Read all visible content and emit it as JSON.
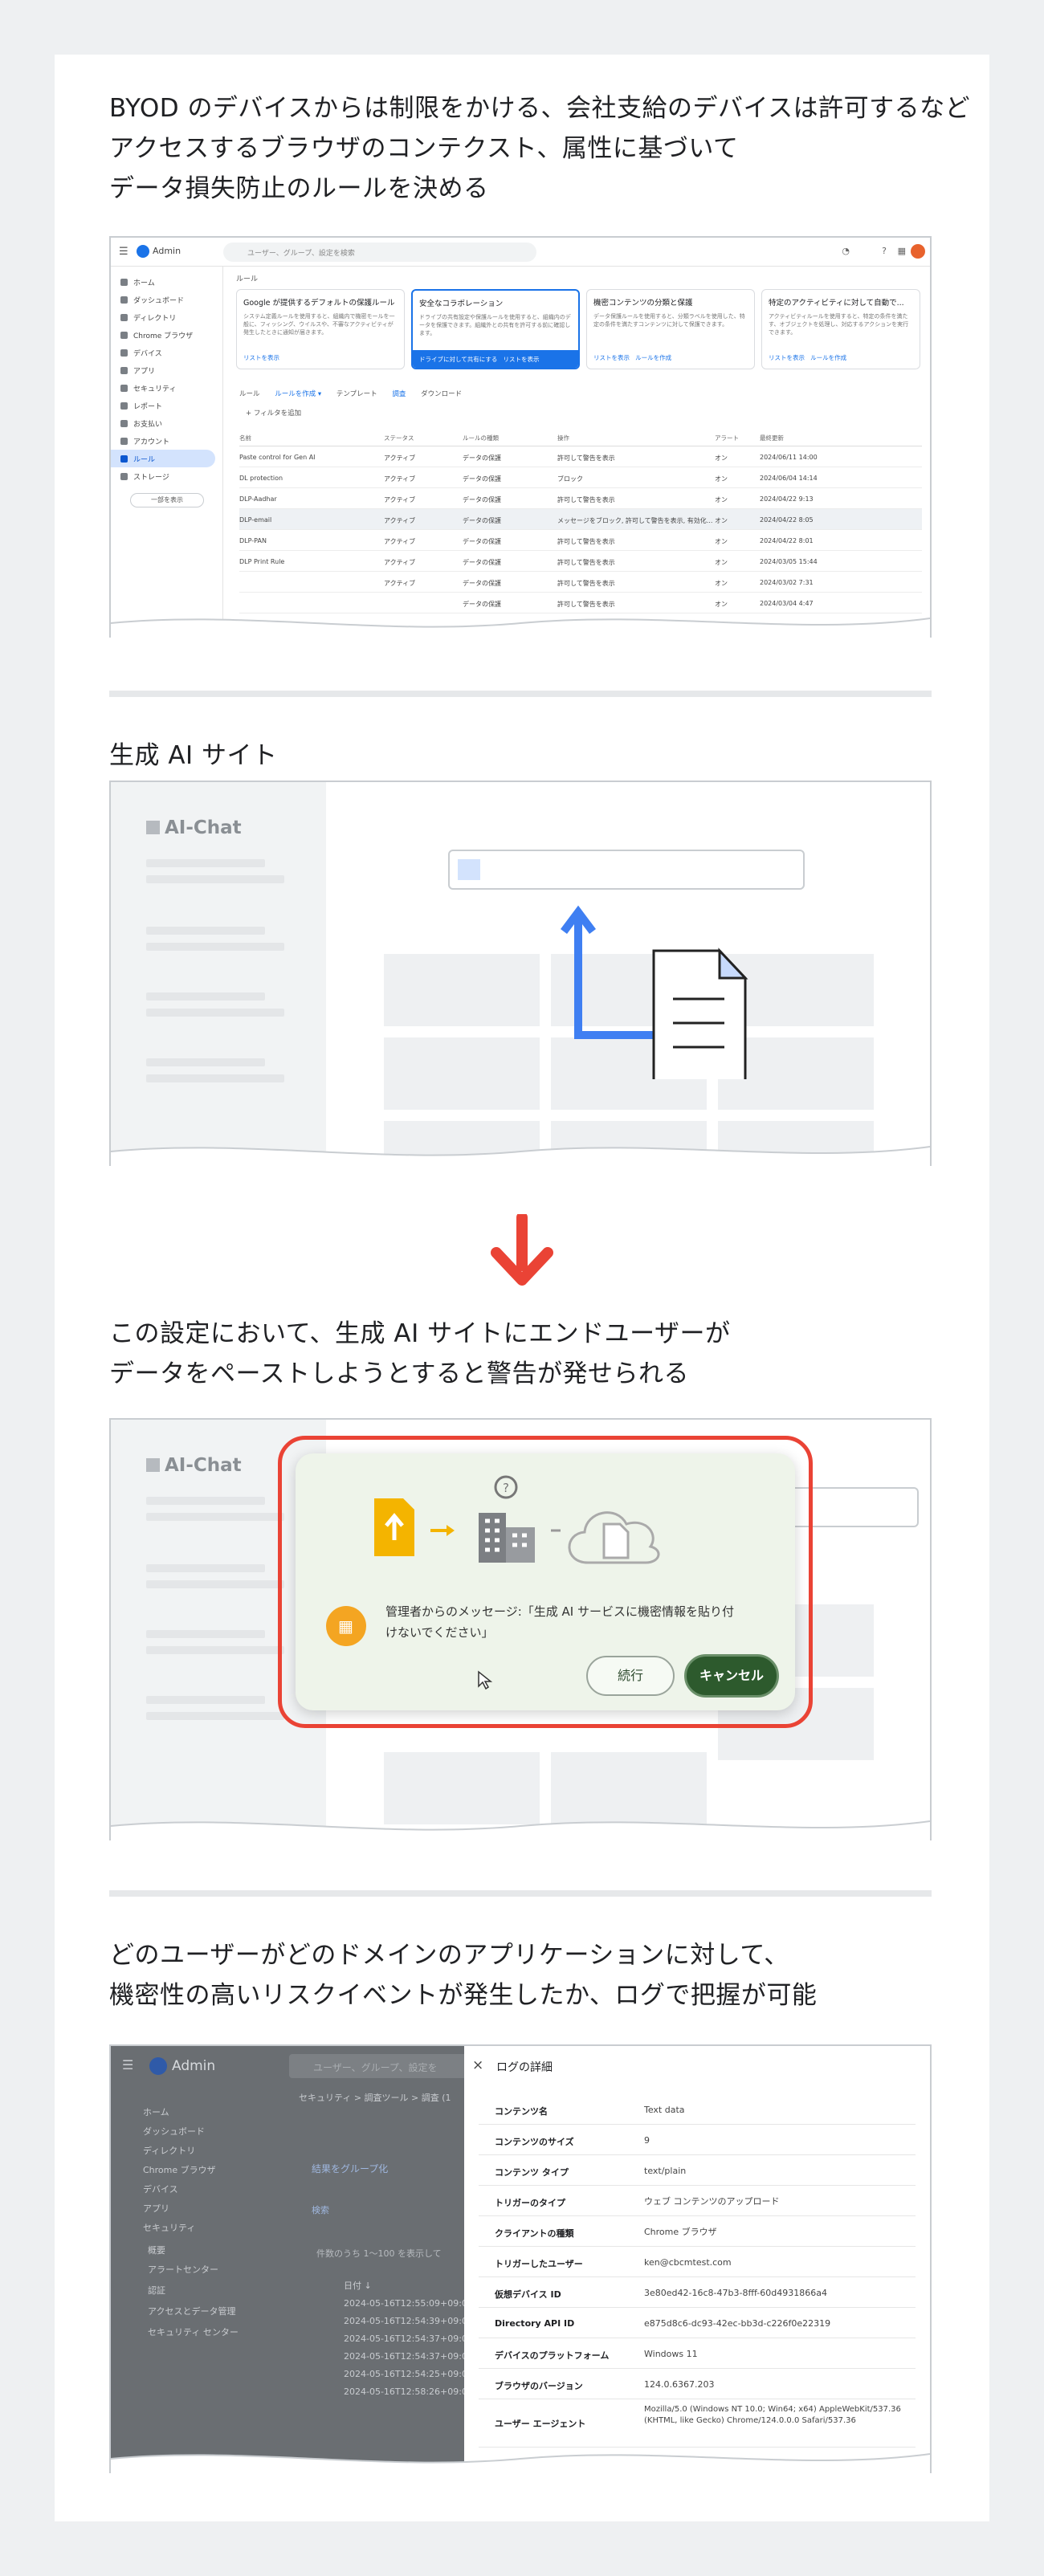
{
  "sections": [
    {
      "heading": "BYOD のデバイスからは制限をかける、会社支給のデバイスは許可するなど\nアクセスするブラウザのコンテクスト、属性に基づいて\nデータ損失防止のルールを決める"
    },
    {
      "heading": "生成 AI サイト"
    },
    {
      "heading": "この設定において、生成 AI サイトにエンドユーザーが\nデータをペーストしようとすると警告が発せられる"
    },
    {
      "heading": "どのユーザーがどのドメインのアプリケーションに対して、\n機密性の高いリスクイベントが発生したか、ログで把握が可能"
    }
  ],
  "admin": {
    "brand": "Admin",
    "search_placeholder": "ユーザー、グループ、設定を検索",
    "breadcrumb": "ルール",
    "sidebar": [
      "ホーム",
      "ダッシュボード",
      "ディレクトリ",
      "Chrome ブラウザ",
      "デバイス",
      "アプリ",
      "セキュリティ",
      "レポート",
      "お支払い",
      "アカウント",
      "ルール",
      "ストレージ"
    ],
    "sidebar_more": "一部を表示",
    "cards": [
      {
        "title": "Google が提供するデフォルトの保護ルール",
        "body": "システム定義ルールを使用すると、組織内で機密モールを一般に、フィッシング、ウイルスや、不審なアクティビティが発生したときに通知が届きます。",
        "link": "リストを表示"
      },
      {
        "title": "安全なコラボレーション",
        "body": "ドライブの共有設定や保護ルールを使用すると、組織内のデータを保護できます。組織外との共有を許可する前に確認します。",
        "link": "リストを表示",
        "action": "ドライブに対して共有にする"
      },
      {
        "title": "機密コンテンツの分類と保護",
        "body": "データ保護ルールを使用すると、分類ラベルを使用した、特定の条件を満たすコンテンツに対して保護できます。",
        "link": "リストを表示",
        "link2": "ルールを作成"
      },
      {
        "title": "特定のアクティビティに対して自動で...",
        "body": "アクティビティルールを使用すると、特定の条件を満たす、オブジェクトを処理し、対応するアクションを実行できます。",
        "link": "リストを表示",
        "link2": "ルールを作成"
      }
    ],
    "tabs": [
      "ルール",
      "ルールを作成 ▾",
      "テンプレート",
      "調査",
      "ダウンロード"
    ],
    "filter": "+ フィルタを追加",
    "columns": [
      "名前",
      "ステータス",
      "ルールの種類",
      "操作",
      "アラート",
      "最終更新"
    ],
    "rows": [
      [
        "Paste control for Gen AI",
        "アクティブ",
        "データの保護",
        "許可して警告を表示",
        "オン",
        "2024/06/11 14:00"
      ],
      [
        "DL protection",
        "アクティブ",
        "データの保護",
        "ブロック",
        "オン",
        "2024/06/04 14:14"
      ],
      [
        "DLP-Aadhar",
        "アクティブ",
        "データの保護",
        "許可して警告を表示",
        "オン",
        "2024/04/22 9:13"
      ],
      [
        "DLP-email",
        "アクティブ",
        "データの保護",
        "メッセージをブロック, 許可して警告を表示, 有効化...",
        "オン",
        "2024/04/22 8:05"
      ],
      [
        "DLP-PAN",
        "アクティブ",
        "データの保護",
        "許可して警告を表示",
        "オン",
        "2024/04/22 8:01"
      ],
      [
        "DLP Print Rule",
        "アクティブ",
        "データの保護",
        "許可して警告を表示",
        "オン",
        "2024/03/05 15:44"
      ],
      [
        "",
        "アクティブ",
        "データの保護",
        "許可して警告を表示",
        "オン",
        "2024/03/02 7:31"
      ],
      [
        "",
        "",
        "データの保護",
        "許可して警告を表示",
        "オン",
        "2024/03/04 4:47"
      ]
    ]
  },
  "aichat": {
    "logo": "AI-Chat"
  },
  "dialog": {
    "message": "管理者からのメッセージ:「生成 AI サービスに機密情報を貼り付けないでください」",
    "continue_label": "続行",
    "cancel_label": "キャンセル"
  },
  "log": {
    "brand": "Admin",
    "search_placeholder": "ユーザー、グループ、設定を",
    "breadcrumb": "セキュリティ > 調査ツール > 調査 (1",
    "sidebar": [
      "ホーム",
      "ダッシュボード",
      "ディレクトリ",
      "Chrome ブラウザ",
      "デバイス",
      "アプリ",
      "セキュリティ",
      "概要",
      "アラートセンター",
      "認証",
      "アクセスとデータ管理",
      "セキュリティ センター"
    ],
    "group_link": "結果をグループ化",
    "search_label": "検索",
    "result_summary": "件数のうち 1〜100 を表示して",
    "date_col": "日付 ↓",
    "dates": [
      "2024-05-16T12:55:09+09:00",
      "2024-05-16T12:54:39+09:00",
      "2024-05-16T12:54:37+09:00",
      "2024-05-16T12:54:37+09:00",
      "2024-05-16T12:54:25+09:00",
      "2024-05-16T12:58:26+09:00"
    ],
    "panel_title": "ログの詳細",
    "details": [
      {
        "key": "コンテンツ名",
        "value": "Text data"
      },
      {
        "key": "コンテンツのサイズ",
        "value": "9"
      },
      {
        "key": "コンテンツ タイプ",
        "value": "text/plain"
      },
      {
        "key": "トリガーのタイプ",
        "value": "ウェブ コンテンツのアップロード"
      },
      {
        "key": "クライアントの種類",
        "value": "Chrome ブラウザ"
      },
      {
        "key": "トリガーしたユーザー",
        "value": "ken@cbcmtest.com"
      },
      {
        "key": "仮想デバイス ID",
        "value": "3e80ed42-16c8-47b3-8fff-60d4931866a4"
      },
      {
        "key": "Directory API ID",
        "value": "e875d8c6-dc93-42ec-bb3d-c226f0e22319"
      },
      {
        "key": "デバイスのプラットフォーム",
        "value": "Windows 11"
      },
      {
        "key": "ブラウザのバージョン",
        "value": "124.0.6367.203"
      },
      {
        "key": "ユーザー エージェント",
        "value": "Mozilla/5.0 (Windows NT 10.0; Win64; x64) AppleWebKit/537.36 (KHTML, like Gecko) Chrome/124.0.0.0 Safari/537.36"
      }
    ]
  }
}
